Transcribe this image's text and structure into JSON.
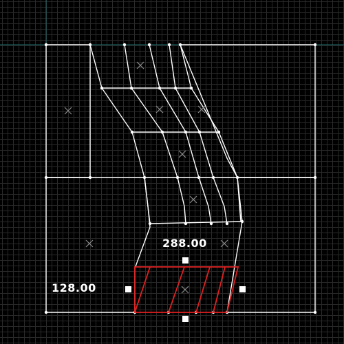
{
  "viewport": {
    "dimensions": {
      "width_value": "288.00",
      "height_value": "128.00"
    },
    "colors": {
      "background": "#000000",
      "grid": "#2a2a2a",
      "guide": "#1f6f6f",
      "wire": "#ffffff",
      "selection": "#e02020",
      "center_marker": "#8a8a8a",
      "handle": "#ffffff"
    }
  }
}
